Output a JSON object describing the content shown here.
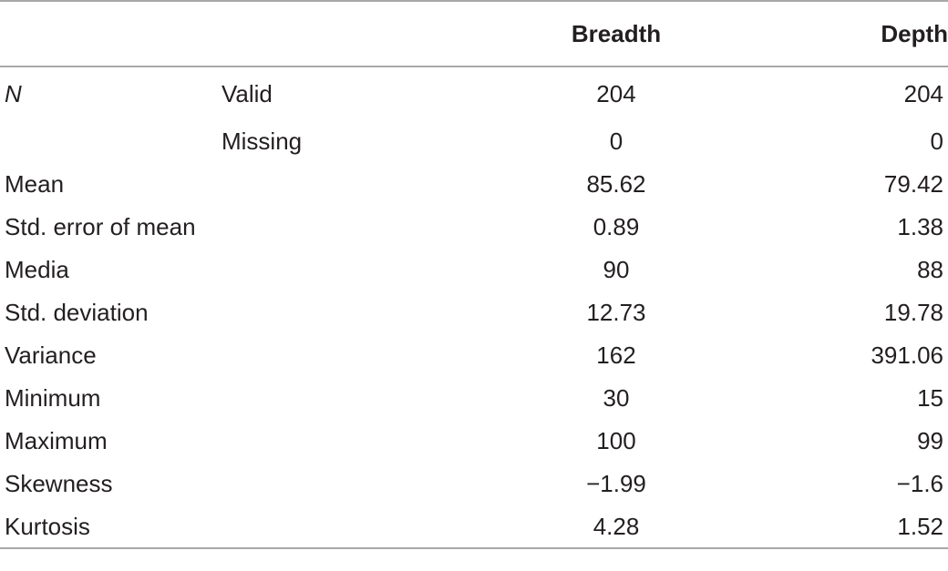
{
  "table": {
    "columns": {
      "row_label": "",
      "row_sublabel": "",
      "breadth": "Breadth",
      "depth": "Depth"
    },
    "rows": [
      {
        "label": "N",
        "label_style": "italic",
        "sublabel": "Valid",
        "breadth": "204",
        "depth": "204"
      },
      {
        "label": "",
        "label_style": "normal",
        "sublabel": "Missing",
        "breadth": "0",
        "depth": "0"
      },
      {
        "label": "Mean",
        "label_style": "normal",
        "sublabel": "",
        "breadth": "85.62",
        "depth": "79.42"
      },
      {
        "label": "Std. error of mean",
        "label_style": "normal",
        "sublabel": "",
        "breadth": "0.89",
        "depth": "1.38"
      },
      {
        "label": "Media",
        "label_style": "normal",
        "sublabel": "",
        "breadth": "90",
        "depth": "88"
      },
      {
        "label": "Std. deviation",
        "label_style": "normal",
        "sublabel": "",
        "breadth": "12.73",
        "depth": "19.78"
      },
      {
        "label": "Variance",
        "label_style": "normal",
        "sublabel": "",
        "breadth": "162",
        "depth": "391.06"
      },
      {
        "label": "Minimum",
        "label_style": "normal",
        "sublabel": "",
        "breadth": "30",
        "depth": "15"
      },
      {
        "label": "Maximum",
        "label_style": "normal",
        "sublabel": "",
        "breadth": "100",
        "depth": "99"
      },
      {
        "label": "Skewness",
        "label_style": "normal",
        "sublabel": "",
        "breadth": "−1.99",
        "depth": "−1.6"
      },
      {
        "label": "Kurtosis",
        "label_style": "normal",
        "sublabel": "",
        "breadth": "4.28",
        "depth": "1.52"
      }
    ]
  },
  "chart_data": {
    "type": "table",
    "title": "",
    "categories": [
      "N Valid",
      "N Missing",
      "Mean",
      "Std. error of mean",
      "Media",
      "Std. deviation",
      "Variance",
      "Minimum",
      "Maximum",
      "Skewness",
      "Kurtosis"
    ],
    "series": [
      {
        "name": "Breadth",
        "values": [
          204,
          0,
          85.62,
          0.89,
          90,
          12.73,
          162,
          30,
          100,
          -1.99,
          4.28
        ]
      },
      {
        "name": "Depth",
        "values": [
          204,
          0,
          79.42,
          1.38,
          88,
          19.78,
          391.06,
          15,
          99,
          -1.6,
          1.52
        ]
      }
    ],
    "xlabel": "",
    "ylabel": "",
    "legend": [
      "Breadth",
      "Depth"
    ],
    "grid": false
  },
  "style": {
    "rule_color": "#a8a8a8",
    "text_color": "#231f20",
    "background": "#ffffff"
  }
}
